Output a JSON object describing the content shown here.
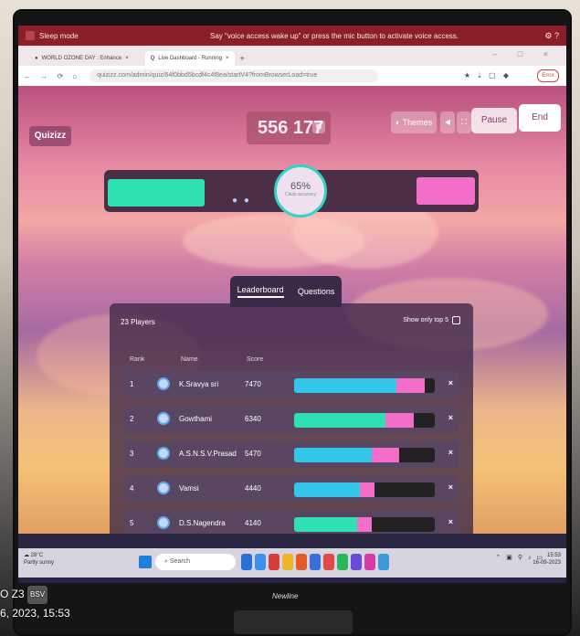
{
  "voice_bar": {
    "app": "Sleep mode",
    "message": "Say \"voice access wake up\" or press the mic button to activate voice access.",
    "icons": [
      "gear-icon",
      "help-icon"
    ]
  },
  "browser": {
    "tabs": [
      {
        "label": "WORLD OZONE DAY : Enhance",
        "icon": "ozone-icon"
      },
      {
        "label": "Live Dashboard - Running",
        "icon": "quizizz-icon"
      }
    ],
    "url": "quizizz.com/admin/quiz/64f0bbd5bcdf4c4f8ea/startV4?fromBrowserLoad=true",
    "profile": "Error"
  },
  "quiz": {
    "logo": "Quizizz",
    "code": "556 177",
    "themes_label": "Themes",
    "pause_label": "Pause",
    "end_label": "End",
    "accuracy": {
      "percent": "65%",
      "label": "Class accuracy",
      "value": 0.65
    },
    "tabs": {
      "leaderboard": "Leaderboard",
      "questions": "Questions"
    },
    "players_count": "23 Players",
    "show_top5": "Show only top 5",
    "columns": {
      "rank": "Rank",
      "name": "Name",
      "score": "Score"
    },
    "rows": [
      {
        "rank": "1",
        "name": "K.Sravya sri",
        "score": "7470",
        "correct": 0.73,
        "incorrect": 0.2,
        "color": "#33c6e8"
      },
      {
        "rank": "2",
        "name": "Gowthami",
        "score": "6340",
        "correct": 0.65,
        "incorrect": 0.2,
        "color": "#2fe0b3"
      },
      {
        "rank": "3",
        "name": "A.S.N.S.V.Prasad",
        "score": "5470",
        "correct": 0.55,
        "incorrect": 0.2,
        "color": "#33c6e8"
      },
      {
        "rank": "4",
        "name": "Vamsi",
        "score": "4440",
        "correct": 0.47,
        "incorrect": 0.1,
        "color": "#33c6e8"
      },
      {
        "rank": "5",
        "name": "D.S.Nagendra",
        "score": "4140",
        "correct": 0.45,
        "incorrect": 0.1,
        "color": "#2fe0b3"
      }
    ],
    "remove_label": "×"
  },
  "taskbar": {
    "weather_temp": "28°C",
    "weather_desc": "Partly sunny",
    "search": "Search",
    "time": "15:53",
    "date": "16-09-2023"
  },
  "bezel_brand": "Newline",
  "overlay": {
    "line1": "O Z3",
    "badge": "BSV",
    "line2": "6, 2023, 15:53"
  }
}
